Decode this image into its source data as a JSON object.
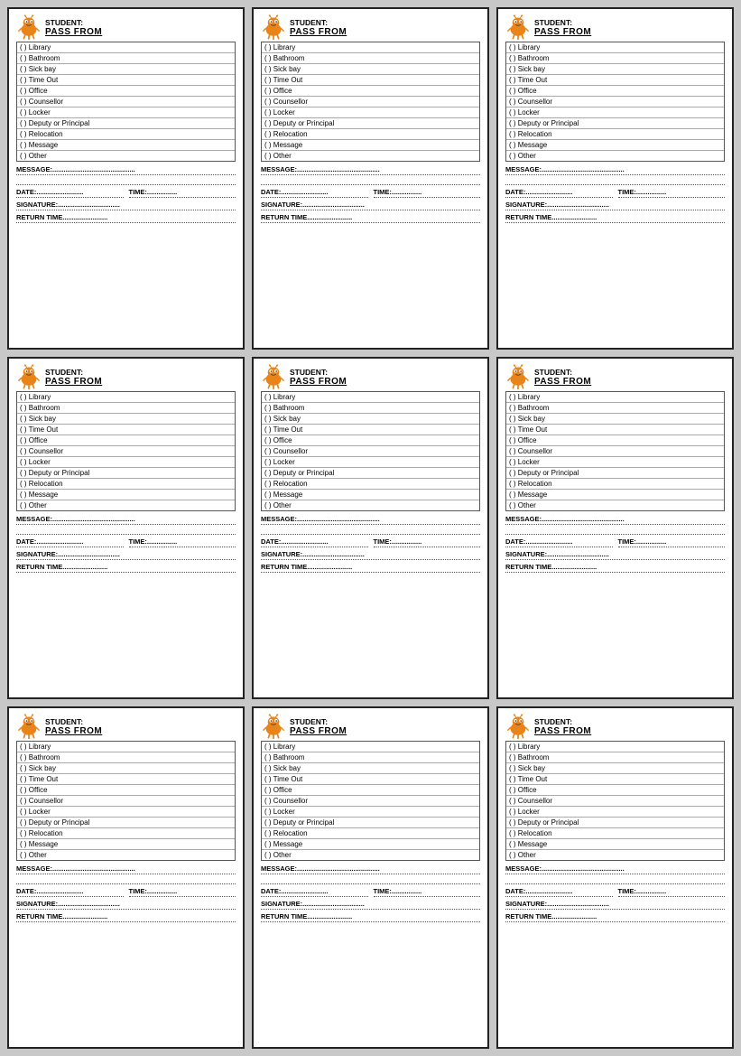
{
  "cards": [
    {
      "student_label": "STUDENT:",
      "pass_from": "PASS FROM",
      "options": [
        "( ) Library",
        "( ) Bathroom",
        "( ) Sick bay",
        "( ) Time Out",
        "( ) Office",
        "( ) Counsellor",
        "( ) Locker",
        "( ) Deputy or Principal",
        "( ) Relocation",
        "( ) Message",
        "( ) Other"
      ],
      "message_label": "MESSAGE:............................................",
      "date_label": "DATE:.........................",
      "time_label": "TIME:................",
      "signature_label": "SIGNATURE:.................................",
      "return_label": "RETURN TIME........................"
    }
  ],
  "card_count": 9
}
